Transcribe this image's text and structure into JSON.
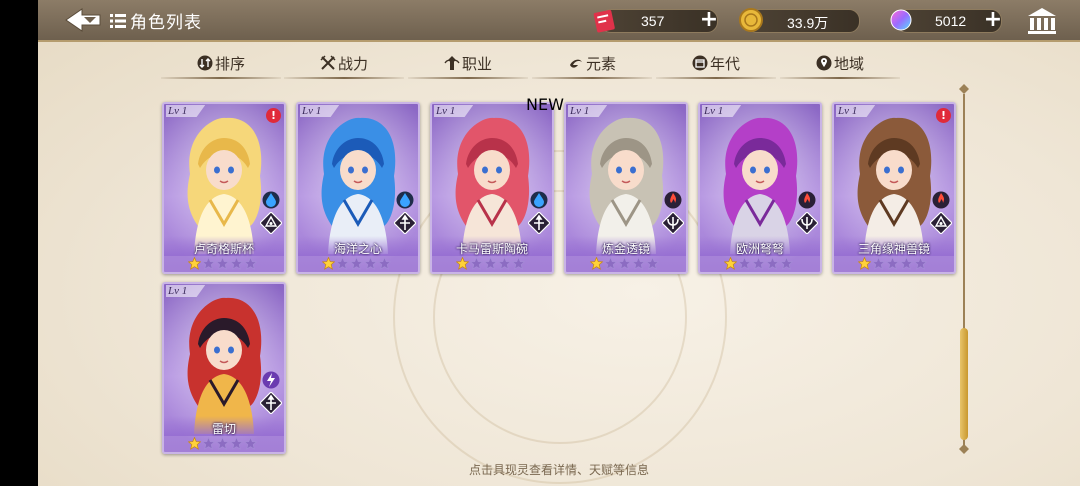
{
  "header": {
    "title": "角色列表",
    "resources": [
      {
        "name": "ticket",
        "value": "357"
      },
      {
        "name": "coins",
        "value": "33.9万"
      },
      {
        "name": "gems",
        "value": "5012"
      }
    ]
  },
  "filters": [
    {
      "label": "排序",
      "icon": "sort-icon"
    },
    {
      "label": "战力",
      "icon": "swords-icon"
    },
    {
      "label": "职业",
      "icon": "job-icon"
    },
    {
      "label": "元素",
      "icon": "element-icon"
    },
    {
      "label": "年代",
      "icon": "era-icon"
    },
    {
      "label": "地域",
      "icon": "location-icon"
    }
  ],
  "cards": [
    {
      "lv": "Lv 1",
      "name": "卢奇格斯杯",
      "stars_filled": 1,
      "stars_total": 5,
      "alert": "!",
      "new": "",
      "element": "water",
      "class": "tri",
      "colors": [
        "#f6d77a",
        "#e8b84a",
        "#fff4d0"
      ]
    },
    {
      "lv": "Lv 1",
      "name": "海洋之心",
      "stars_filled": 1,
      "stars_total": 5,
      "alert": "",
      "new": "",
      "element": "water",
      "class": "fleur",
      "colors": [
        "#3a8fe6",
        "#1c5bb8",
        "#e9eef7"
      ]
    },
    {
      "lv": "Lv 1",
      "name": "卡马雷斯陶碗",
      "stars_filled": 1,
      "stars_total": 5,
      "alert": "",
      "new": "NEW",
      "element": "water",
      "class": "fleur",
      "colors": [
        "#e2556a",
        "#b8324a",
        "#f6e5d8"
      ]
    },
    {
      "lv": "Lv 1",
      "name": "炼金透镜",
      "stars_filled": 1,
      "stars_total": 5,
      "alert": "",
      "new": "",
      "element": "fire",
      "class": "trident",
      "colors": [
        "#c8c2b4",
        "#9d9586",
        "#f2f0ea"
      ]
    },
    {
      "lv": "Lv 1",
      "name": "欧洲弩弩",
      "stars_filled": 1,
      "stars_total": 5,
      "alert": "",
      "new": "",
      "element": "fire",
      "class": "trident",
      "colors": [
        "#b43fc8",
        "#7a2a9a",
        "#d9d3e6"
      ]
    },
    {
      "lv": "Lv 1",
      "name": "三角缘神兽镜",
      "stars_filled": 1,
      "stars_total": 5,
      "alert": "!",
      "new": "",
      "element": "fire",
      "class": "tri",
      "colors": [
        "#8b5a3a",
        "#5e3a22",
        "#f4ede6"
      ]
    },
    {
      "lv": "Lv 1",
      "name": "雷切",
      "stars_filled": 1,
      "stars_total": 5,
      "alert": "",
      "new": "",
      "element": "thunder",
      "class": "fleur",
      "colors": [
        "#c8322e",
        "#2a1a2a",
        "#f0b64a"
      ]
    }
  ],
  "hint": "点击具现灵查看详情、天赋等信息",
  "colors": {
    "accent_gold": "#e8c46a",
    "card_purple": "#9a74d0",
    "alert_red": "#e02a3a"
  }
}
